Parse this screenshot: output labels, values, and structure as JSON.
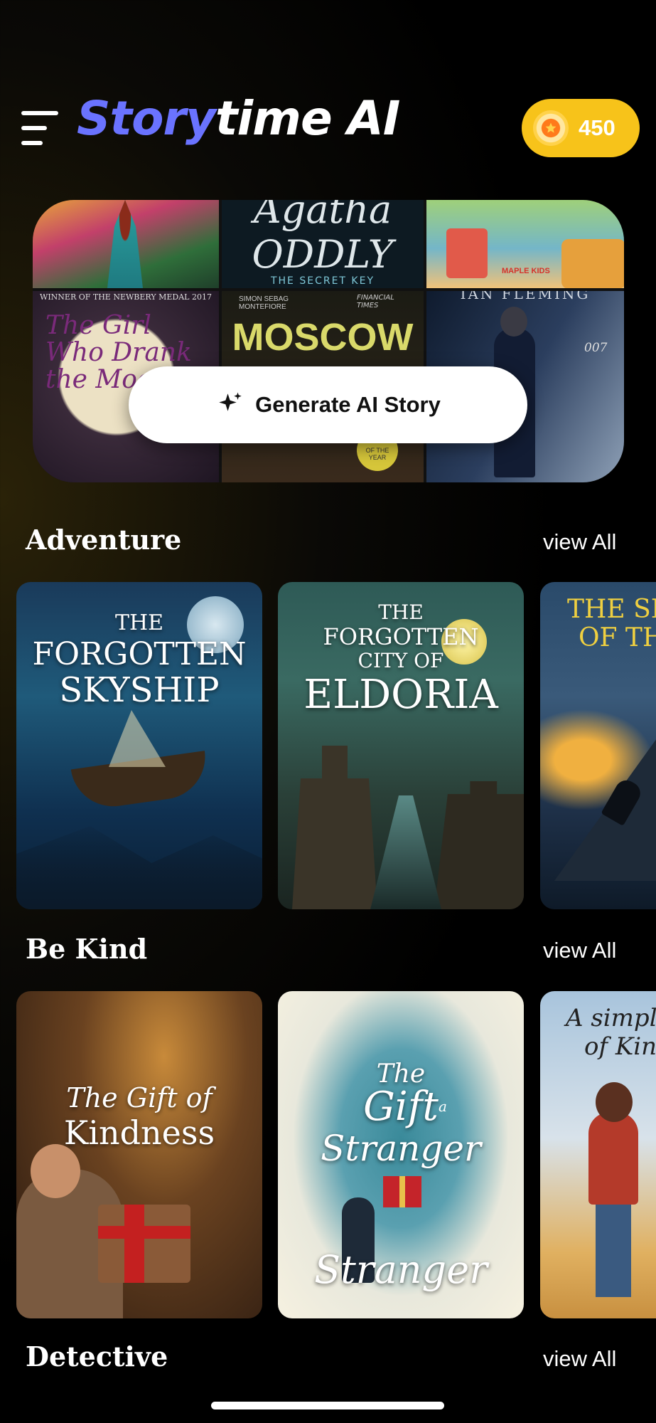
{
  "header": {
    "logo_part1": "Story",
    "logo_part2": "time AI",
    "coins": "450",
    "menu_icon": "hamburger-menu-icon",
    "coin_icon": "star-coin-icon"
  },
  "hero": {
    "generate_label": "Generate AI Story",
    "generate_icon": "sparkle-icon",
    "covers": [
      {
        "title": ""
      },
      {
        "title": "Agatha ODDLY",
        "subtitle": "THE SECRET KEY"
      },
      {
        "title": "",
        "badge": "MAPLE KIDS"
      },
      {
        "title": "The Girl Who Drank the Moon",
        "top": "WINNER OF THE NEWBERY MEDAL 2017"
      },
      {
        "title": "MOSCOW",
        "top_left": "SIMON SEBAG MONTEFIORE",
        "top_right": "FINANCIAL TIMES",
        "badge": "OF THE YEAR"
      },
      {
        "title": "",
        "top": "IAN FLEMING",
        "badge": "007"
      }
    ]
  },
  "sections": [
    {
      "title": "Adventure",
      "view_all": "view All",
      "cards": [
        {
          "line1": "THE",
          "line2": "FORGOTTEN",
          "line3": "SKYSHIP"
        },
        {
          "line1": "THE",
          "line2": "FORGOTTEN",
          "line3": "CITY OF",
          "line4": "ELDORIA"
        },
        {
          "line1": "THE SE",
          "line2": "OF TH"
        }
      ]
    },
    {
      "title": "Be Kind",
      "view_all": "view All",
      "cards": [
        {
          "line1": "The Gift of",
          "line2": "Kindness"
        },
        {
          "line1": "The",
          "line2": "Gift",
          "line3": "a",
          "line4": "Stranger",
          "line5": "Stranger"
        },
        {
          "line1": "A simple",
          "line2": "of Kin"
        }
      ]
    },
    {
      "title": "Detective",
      "view_all": "view All"
    }
  ],
  "colors": {
    "brand_blue": "#6a73ff",
    "coin_yellow": "#f7c31a",
    "background": "#000000"
  }
}
